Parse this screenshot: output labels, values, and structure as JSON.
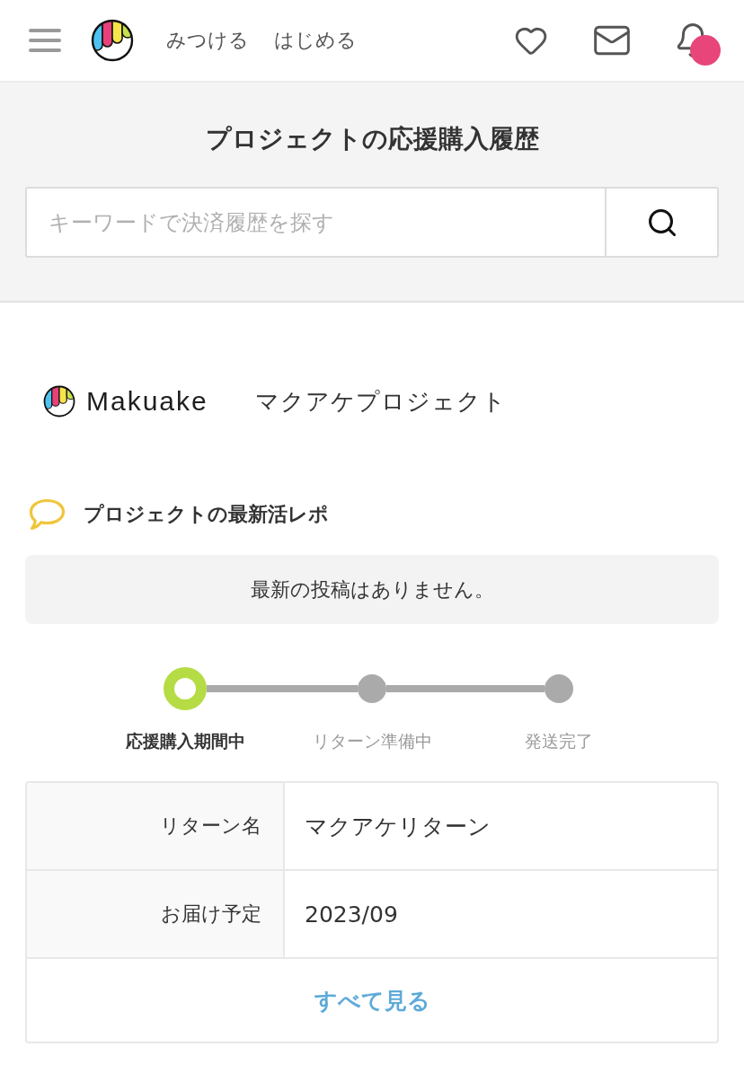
{
  "header": {
    "nav": [
      "みつける",
      "はじめる"
    ],
    "notifications": {
      "unread": true
    }
  },
  "page_title": "プロジェクトの応援購入履歴",
  "search": {
    "placeholder": "キーワードで決済履歴を探す"
  },
  "project": {
    "brand": "Makuake",
    "name": "マクアケプロジェクト",
    "reports": {
      "heading": "プロジェクトの最新活レポ",
      "empty_message": "最新の投稿はありません。"
    },
    "steps": [
      {
        "label": "応援購入期間中",
        "current": true
      },
      {
        "label": "リターン準備中",
        "current": false
      },
      {
        "label": "発送完了",
        "current": false
      }
    ],
    "details": [
      {
        "label": "リターン名",
        "value": "マクアケリターン"
      },
      {
        "label": "お届け予定",
        "value": "2023/09"
      }
    ],
    "view_all": "すべて見る"
  }
}
